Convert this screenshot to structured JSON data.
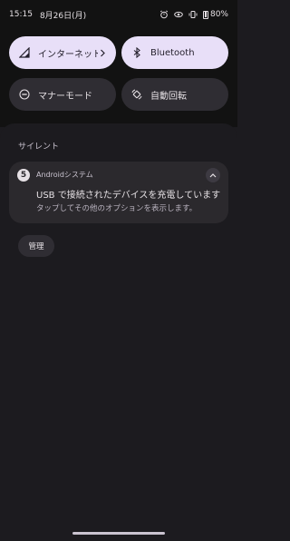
{
  "status_bar": {
    "time": "15:15",
    "date": "8月26日(月)",
    "battery": "80%",
    "icons": [
      "alarm-icon",
      "eye-icon",
      "vibrate-icon",
      "battery-icon"
    ]
  },
  "quick_settings": {
    "tiles": [
      {
        "label": "インターネット",
        "icon": "signal-icon",
        "active": true,
        "has_chevron": true
      },
      {
        "label": "Bluetooth",
        "icon": "bluetooth-icon",
        "active": true
      },
      {
        "label": "マナーモード",
        "icon": "do-not-disturb-icon",
        "active": false
      },
      {
        "label": "自動回転",
        "icon": "auto-rotate-icon",
        "active": false
      }
    ]
  },
  "notifications": {
    "section_label": "サイレント",
    "items": [
      {
        "app_name": "Androidシステム",
        "app_icon_letter": "5",
        "title": "USB で接続されたデバイスを充電しています",
        "text": "タップしてその他のオプションを表示します。"
      }
    ],
    "manage_label": "管理"
  },
  "colors": {
    "tile_active": "#e8dff8",
    "tile_inactive": "#2f2d33",
    "background": "#1c1b1f"
  }
}
